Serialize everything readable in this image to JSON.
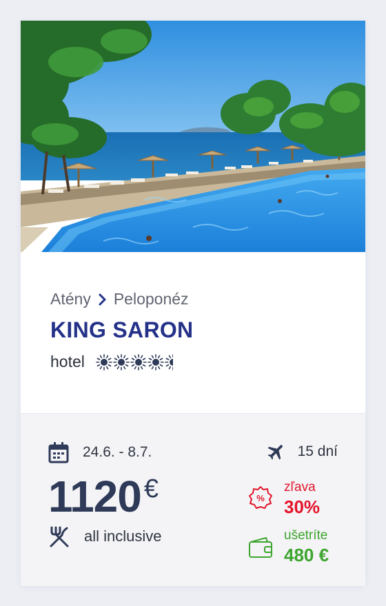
{
  "offer": {
    "photo_alt": "hotel pool by the sea",
    "breadcrumb": {
      "from": "Atény",
      "to": "Peloponéz"
    },
    "hotel_name": "KING SARON",
    "category": {
      "type": "hotel",
      "rating": 4.5,
      "max_rating": 5
    },
    "dates": "24.6. - 8.7.",
    "duration": "15 dní",
    "price": {
      "value": "1120",
      "currency": "€"
    },
    "board": "all inclusive",
    "discount": {
      "label": "zľava",
      "value": "30%"
    },
    "savings": {
      "label": "ušetríte",
      "value": "480 €"
    }
  },
  "colors": {
    "hotel_name": "#243189",
    "price": "#2e3a58",
    "discount": "#e3152b",
    "savings": "#3da42e",
    "background": "#eceef4"
  },
  "icons": {
    "breadcrumb_separator": "chevron-right-icon",
    "rating": "sun-icon",
    "dates": "calendar-icon",
    "duration": "airplane-icon",
    "board": "cutlery-icon",
    "discount": "percent-badge-icon",
    "savings": "wallet-icon"
  }
}
